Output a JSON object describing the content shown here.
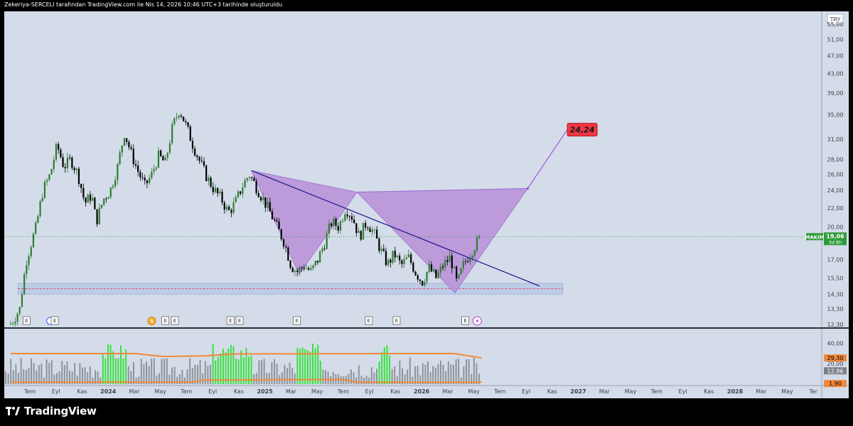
{
  "header": {
    "caption": "Zekeriya-SERCELI tarafından TradingView.com ile Nis 14, 2026 10:46 UTC+3 tarihinde oluşturuldu"
  },
  "footer": {
    "brand": "TradingView",
    "logo_icon": "tradingview-logo-icon"
  },
  "price_axis": {
    "currency": "TRY",
    "ticks": [
      "55,00",
      "51,00",
      "47,00",
      "43,00",
      "39,00",
      "35,00",
      "31,00",
      "28,00",
      "26,00",
      "24,00",
      "22,00",
      "20,00",
      "17,00",
      "15,50",
      "14,30",
      "13,30",
      "12,30"
    ],
    "symbol_tag": "MAKIM",
    "last_price": "19,06",
    "countdown": "3d 8h"
  },
  "indicator_axis": {
    "ticks": [
      "40,00",
      "20,00"
    ],
    "tag_orange": "29,30",
    "tag_gray": "12,96",
    "tag_orange_low": "1,90"
  },
  "time_axis": {
    "labels": [
      "Tem",
      "Eyl",
      "Kas",
      "2024",
      "Mar",
      "May",
      "Tem",
      "Eyl",
      "Kas",
      "2025",
      "Mar",
      "May",
      "Tem",
      "Eyl",
      "Kas",
      "2026",
      "Mar",
      "May",
      "Tem",
      "Eyl",
      "Kas",
      "2027",
      "Mar",
      "May",
      "Tem",
      "Eyl",
      "Kas",
      "2028",
      "Mar",
      "May",
      "Ter"
    ]
  },
  "events": [
    {
      "type": "E"
    },
    {
      "type": "dividend-blue"
    },
    {
      "type": "E"
    },
    {
      "type": "S"
    },
    {
      "type": "E"
    },
    {
      "type": "E"
    },
    {
      "type": "E"
    },
    {
      "type": "E"
    },
    {
      "type": "E"
    },
    {
      "type": "E"
    },
    {
      "type": "E"
    },
    {
      "type": "E"
    },
    {
      "type": "lightning"
    }
  ],
  "annotation": {
    "target_label": "24,24"
  },
  "colors": {
    "background": "#d4dce9",
    "candle_up": "#2e7d32",
    "candle_down": "#000000",
    "pattern_fill": "#b88fd8",
    "trendline": "#2a1f8f",
    "target_box": "#f23645",
    "support_zone": "#b7c7e6",
    "last_price": "#2e9b3a",
    "volume_gray": "#8f9399",
    "volume_green": "#37e23f",
    "indicator_orange": "#f0883a"
  },
  "chart_data": {
    "type": "candlestick",
    "symbol": "MAKIM",
    "currency": "TRY",
    "y_scale": "log",
    "ylim": [
      12.3,
      57.0
    ],
    "x_range": [
      "2023-06",
      "2028-05"
    ],
    "price_path": [
      [
        "2023-06-15",
        12.3
      ],
      [
        "2023-07-05",
        13.3
      ],
      [
        "2023-07-20",
        17.0
      ],
      [
        "2023-08-10",
        20.0
      ],
      [
        "2023-08-25",
        24.0
      ],
      [
        "2023-09-10",
        26.0
      ],
      [
        "2023-09-25",
        30.0
      ],
      [
        "2023-10-10",
        27.0
      ],
      [
        "2023-10-25",
        28.0
      ],
      [
        "2023-11-10",
        26.0
      ],
      [
        "2023-11-25",
        22.5
      ],
      [
        "2023-12-10",
        23.5
      ],
      [
        "2023-12-20",
        20.5
      ],
      [
        "2024-01-05",
        23.0
      ],
      [
        "2024-01-20",
        24.0
      ],
      [
        "2024-02-05",
        27.0
      ],
      [
        "2024-02-20",
        32.0
      ],
      [
        "2024-03-05",
        29.0
      ],
      [
        "2024-03-20",
        26.5
      ],
      [
        "2024-04-05",
        24.5
      ],
      [
        "2024-04-20",
        26.0
      ],
      [
        "2024-05-05",
        28.5
      ],
      [
        "2024-05-20",
        27.5
      ],
      [
        "2024-06-05",
        33.0
      ],
      [
        "2024-06-20",
        36.0
      ],
      [
        "2024-07-05",
        33.0
      ],
      [
        "2024-07-20",
        30.0
      ],
      [
        "2024-08-05",
        27.5
      ],
      [
        "2024-08-20",
        25.5
      ],
      [
        "2024-09-05",
        24.0
      ],
      [
        "2024-09-20",
        23.0
      ],
      [
        "2024-10-05",
        21.5
      ],
      [
        "2024-10-20",
        22.5
      ],
      [
        "2024-11-05",
        24.5
      ],
      [
        "2024-11-20",
        26.0
      ],
      [
        "2024-12-05",
        24.5
      ],
      [
        "2024-12-20",
        23.0
      ],
      [
        "2025-01-05",
        21.5
      ],
      [
        "2025-01-20",
        20.0
      ],
      [
        "2025-02-05",
        18.5
      ],
      [
        "2025-02-20",
        16.5
      ],
      [
        "2025-03-05",
        16.0
      ],
      [
        "2025-03-20",
        16.5
      ],
      [
        "2025-04-05",
        16.0
      ],
      [
        "2025-04-20",
        17.0
      ],
      [
        "2025-05-05",
        18.5
      ],
      [
        "2025-05-20",
        20.5
      ],
      [
        "2025-06-05",
        20.0
      ],
      [
        "2025-06-20",
        22.0
      ],
      [
        "2025-07-05",
        21.0
      ],
      [
        "2025-07-20",
        19.0
      ],
      [
        "2025-08-05",
        20.5
      ],
      [
        "2025-08-20",
        19.5
      ],
      [
        "2025-09-05",
        17.8
      ],
      [
        "2025-09-20",
        16.6
      ],
      [
        "2025-10-05",
        17.5
      ],
      [
        "2025-10-20",
        16.5
      ],
      [
        "2025-11-05",
        17.2
      ],
      [
        "2025-11-20",
        16.0
      ],
      [
        "2025-12-05",
        15.2
      ],
      [
        "2025-12-20",
        16.3
      ],
      [
        "2026-01-05",
        15.5
      ],
      [
        "2026-01-20",
        16.5
      ],
      [
        "2026-02-05",
        17.2
      ],
      [
        "2026-02-20",
        15.0
      ],
      [
        "2026-03-05",
        16.5
      ],
      [
        "2026-03-20",
        17.5
      ],
      [
        "2026-04-01",
        18.3
      ],
      [
        "2026-04-14",
        19.06
      ]
    ],
    "bat_pattern": [
      [
        "2024-11-25",
        26.5
      ],
      [
        "2025-03-10",
        15.8
      ],
      [
        "2025-07-15",
        23.8
      ],
      [
        "2026-02-15",
        14.4
      ],
      [
        "2026-07-25",
        24.24
      ]
    ],
    "bat_connector": [
      "2025-07-15",
      23.8,
      "2026-07-25",
      24.24
    ],
    "trendline": [
      [
        "2024-11-25",
        26.5
      ],
      [
        "2026-08-20",
        14.9
      ]
    ],
    "projection_line": [
      [
        "2026-07-25",
        24.24
      ],
      [
        "2026-10-20",
        32.5
      ]
    ],
    "target": "24,24",
    "support_zone": {
      "low": 14.3,
      "high": 15.1,
      "mid": 14.7,
      "from": "2023-07-01",
      "to": "2026-10-10"
    },
    "last_price": 19.06,
    "volume_indicator": {
      "ylim": [
        0,
        52
      ],
      "upper_line": [
        [
          "2023-06",
          29.8
        ],
        [
          "2024-03",
          29.8
        ],
        [
          "2024-05",
          27.0
        ],
        [
          "2024-08",
          27.5
        ],
        [
          "2024-10",
          29.5
        ],
        [
          "2025-09",
          29.8
        ],
        [
          "2026-02",
          29.8
        ],
        [
          "2026-04",
          25.5
        ]
      ],
      "lower_line": [
        [
          "2023-06",
          2.0
        ],
        [
          "2024-07",
          2.0
        ],
        [
          "2024-08",
          4.0
        ],
        [
          "2025-06",
          4.5
        ],
        [
          "2025-07",
          1.8
        ],
        [
          "2026-04",
          1.9
        ]
      ],
      "highlight_windows": [
        [
          "2024-01",
          "2024-02"
        ],
        [
          "2024-09",
          "2024-11"
        ],
        [
          "2025-03",
          "2025-04"
        ],
        [
          "2025-09",
          "2025-09"
        ]
      ]
    },
    "event_dates": [
      "2023-07-20",
      "2023-09-10",
      "2023-09-20",
      "2024-04-20",
      "2024-05-20",
      "2024-06-10",
      "2024-10-10",
      "2024-10-30",
      "2025-03-05",
      "2025-08-10",
      "2025-10-10",
      "2026-03-10",
      "2026-04-05"
    ]
  }
}
